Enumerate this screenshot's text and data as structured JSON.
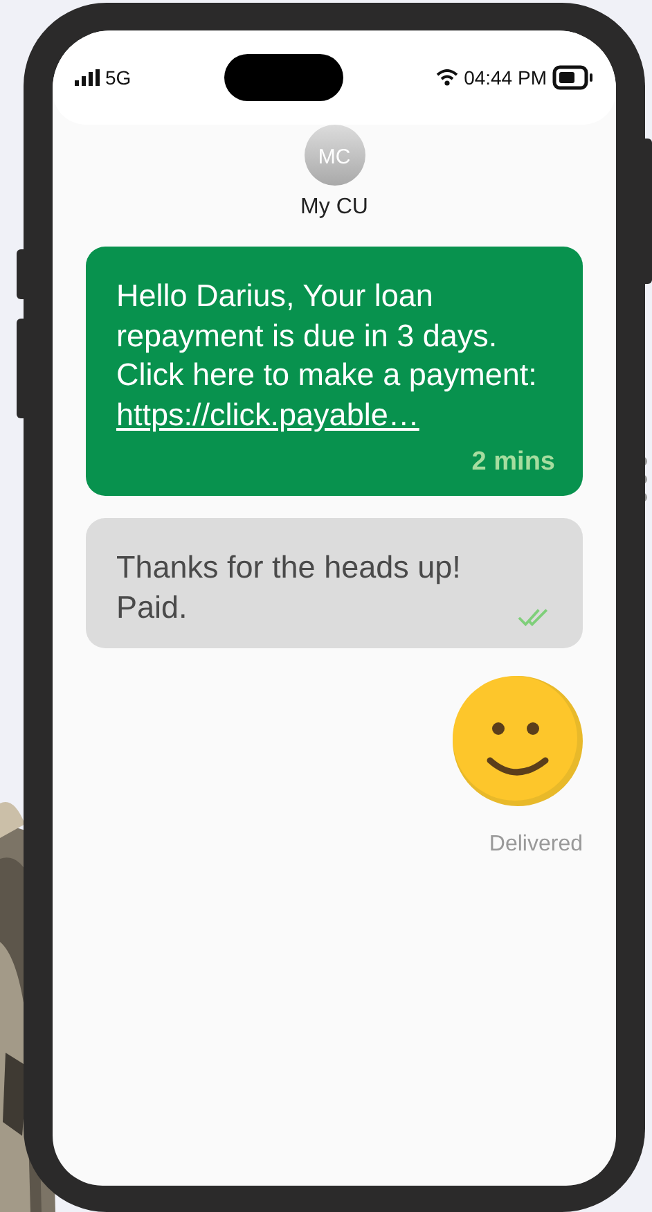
{
  "status_bar": {
    "network": "5G",
    "time": "04:44 PM"
  },
  "contact": {
    "initials": "MC",
    "name": "My CU"
  },
  "messages": [
    {
      "kind": "incoming",
      "text": "Hello Darius, Your loan repayment is due in 3 days. Click here to make a payment:",
      "link": "https://click.payable…",
      "time": "2 mins"
    },
    {
      "kind": "outgoing",
      "text": "Thanks for the heads up! Paid.",
      "read": true
    },
    {
      "kind": "sticker",
      "status": "Delivered"
    }
  ]
}
